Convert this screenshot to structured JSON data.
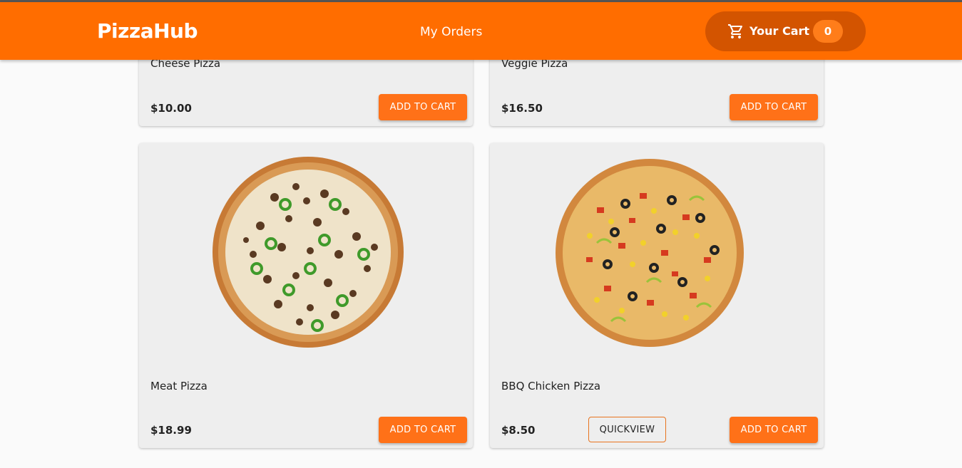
{
  "header": {
    "brand": "PizzaHub",
    "nav_orders": "My Orders",
    "cart_label": "Your Cart",
    "cart_count": "0"
  },
  "products": [
    {
      "name": "Cheese Pizza",
      "price": "$10.00",
      "add_label": "ADD TO CART"
    },
    {
      "name": "Veggie Pizza",
      "price": "$16.50",
      "add_label": "ADD TO CART"
    },
    {
      "name": "Meat Pizza",
      "price": "$18.99",
      "add_label": "ADD TO CART"
    },
    {
      "name": "BBQ Chicken Pizza",
      "price": "$8.50",
      "add_label": "ADD TO CART",
      "quickview_label": "QUICKVIEW"
    }
  ],
  "colors": {
    "header": "#ff6d00",
    "cart_pill": "#d35400",
    "button": "#ff7118",
    "card": "#eeeeee"
  }
}
